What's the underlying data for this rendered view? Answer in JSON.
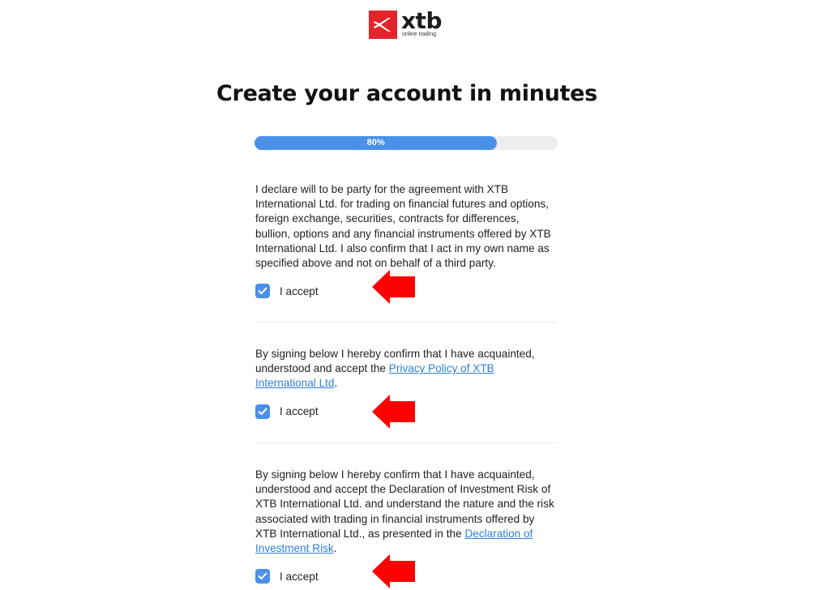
{
  "brand": {
    "name": "xtb",
    "tagline": "online trading",
    "color": "#e3242b"
  },
  "page": {
    "title": "Create your account in minutes"
  },
  "progress": {
    "label": "80%",
    "value": 0.8,
    "fill_color": "#4a90e8"
  },
  "sections": [
    {
      "text_before": "I declare will to be party for the agreement with XTB International Ltd. for trading on financial futures and options, foreign exchange, securities, contracts for differences, bullion, options and any financial instruments offered by XTB International Ltd. I also confirm that I act in my own name as specified above and not on behalf of a third party.",
      "link_text": "",
      "text_after": "",
      "accept_label": "I accept",
      "checked": true
    },
    {
      "text_before": "By signing below I hereby confirm that I have acquainted, understood and accept the ",
      "link_text": "Privacy Policy of XTB International Ltd",
      "text_after": ".",
      "accept_label": "I accept",
      "checked": true
    },
    {
      "text_before": "By signing below I hereby confirm that I have acquainted, understood and accept the Declaration of Investment Risk of XTB International Ltd. and understand the nature and the risk associated with trading in financial instruments offered by XTB International Ltd., as presented in the ",
      "link_text": "Declaration of Investment Risk",
      "text_after": ".",
      "accept_label": "I accept",
      "checked": true
    }
  ],
  "annotation": {
    "arrow_color": "#ff0000",
    "icon": "left-arrow-icon"
  }
}
